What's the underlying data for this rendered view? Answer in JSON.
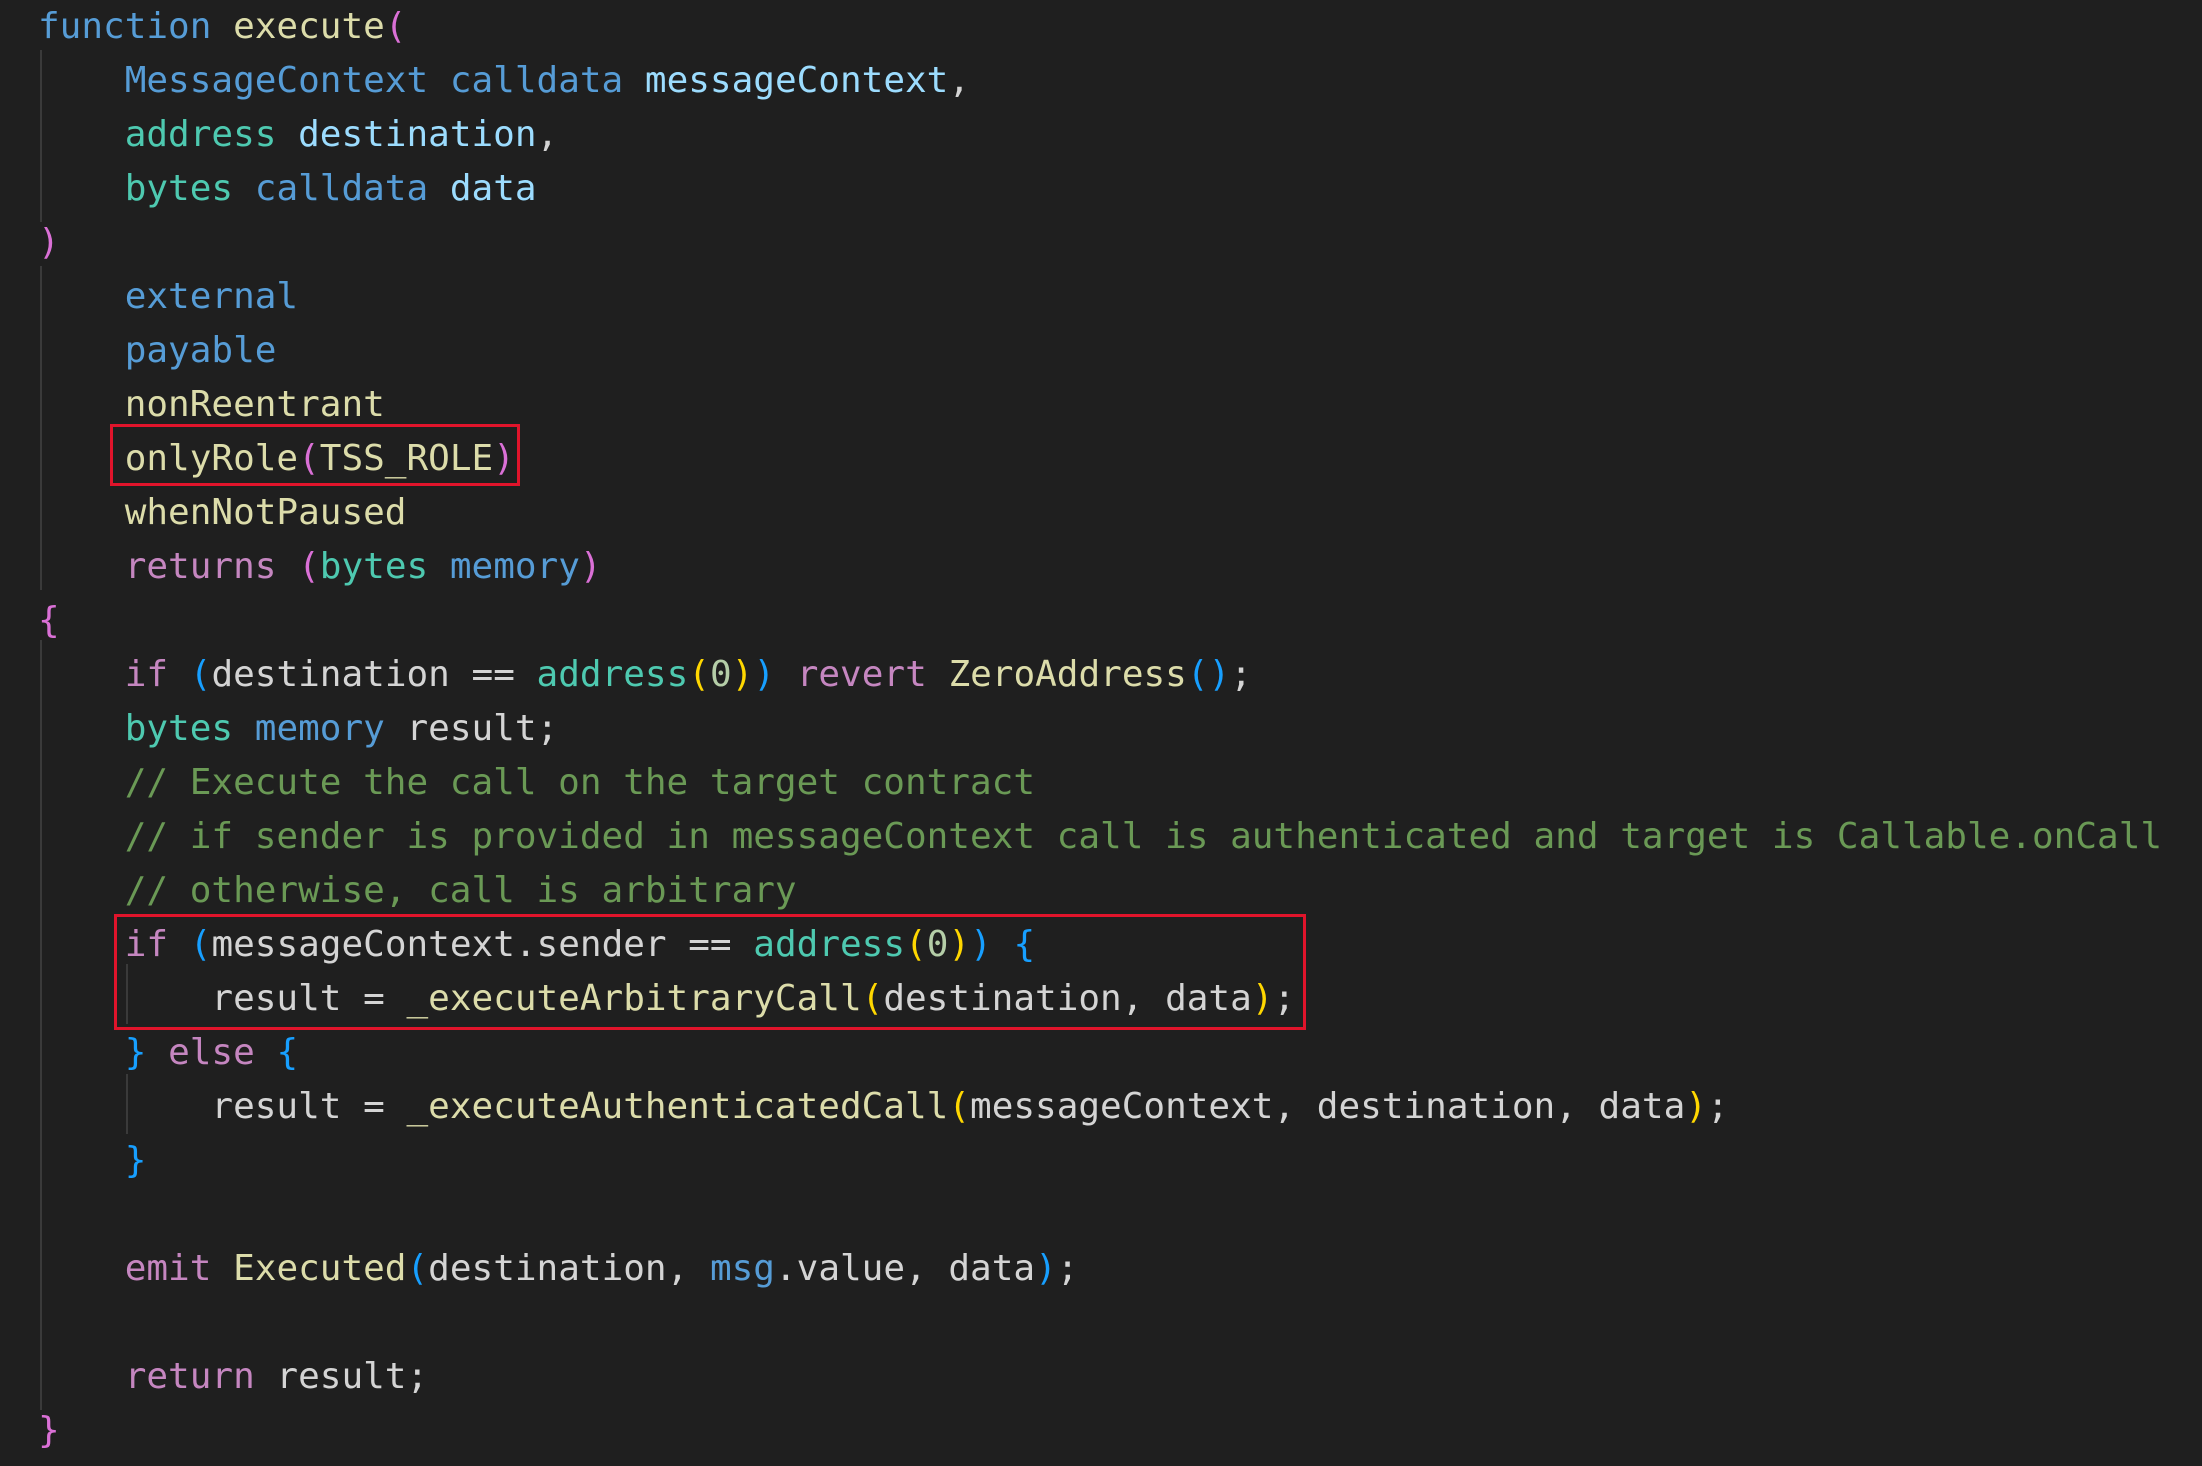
{
  "editor": {
    "highlight_color": "#e0142b",
    "lines": [
      [
        {
          "t": "function",
          "c": "kw-blue"
        },
        {
          "t": " "
        },
        {
          "t": "execute",
          "c": "fn"
        },
        {
          "t": "(",
          "c": "br-p"
        }
      ],
      [
        {
          "t": "    "
        },
        {
          "t": "MessageContext",
          "c": "kw-blue"
        },
        {
          "t": " "
        },
        {
          "t": "calldata",
          "c": "kw-blue"
        },
        {
          "t": " "
        },
        {
          "t": "messageContext",
          "c": "var"
        },
        {
          "t": ","
        }
      ],
      [
        {
          "t": "    "
        },
        {
          "t": "address",
          "c": "type"
        },
        {
          "t": " "
        },
        {
          "t": "destination",
          "c": "var"
        },
        {
          "t": ","
        }
      ],
      [
        {
          "t": "    "
        },
        {
          "t": "bytes",
          "c": "type"
        },
        {
          "t": " "
        },
        {
          "t": "calldata",
          "c": "kw-blue"
        },
        {
          "t": " "
        },
        {
          "t": "data",
          "c": "var"
        }
      ],
      [
        {
          "t": ")",
          "c": "br-p"
        }
      ],
      [
        {
          "t": "    "
        },
        {
          "t": "external",
          "c": "kw-blue"
        }
      ],
      [
        {
          "t": "    "
        },
        {
          "t": "payable",
          "c": "kw-blue"
        }
      ],
      [
        {
          "t": "    "
        },
        {
          "t": "nonReentrant",
          "c": "fn"
        }
      ],
      [
        {
          "t": "    "
        },
        {
          "t": "onlyRole",
          "c": "fn"
        },
        {
          "t": "(",
          "c": "br-p"
        },
        {
          "t": "TSS_ROLE",
          "c": "fn"
        },
        {
          "t": ")",
          "c": "br-p"
        }
      ],
      [
        {
          "t": "    "
        },
        {
          "t": "whenNotPaused",
          "c": "fn"
        }
      ],
      [
        {
          "t": "    "
        },
        {
          "t": "returns",
          "c": "kw-purple"
        },
        {
          "t": " "
        },
        {
          "t": "(",
          "c": "br-p"
        },
        {
          "t": "bytes",
          "c": "type"
        },
        {
          "t": " "
        },
        {
          "t": "memory",
          "c": "kw-blue"
        },
        {
          "t": ")",
          "c": "br-p"
        }
      ],
      [
        {
          "t": "{",
          "c": "br-p"
        }
      ],
      [
        {
          "t": "    "
        },
        {
          "t": "if",
          "c": "kw-purple"
        },
        {
          "t": " "
        },
        {
          "t": "(",
          "c": "br-b"
        },
        {
          "t": "destination == "
        },
        {
          "t": "address",
          "c": "type"
        },
        {
          "t": "(",
          "c": "br-y"
        },
        {
          "t": "0",
          "c": "num"
        },
        {
          "t": ")",
          "c": "br-y"
        },
        {
          "t": ")",
          "c": "br-b"
        },
        {
          "t": " "
        },
        {
          "t": "revert",
          "c": "kw-purple"
        },
        {
          "t": " "
        },
        {
          "t": "ZeroAddress",
          "c": "fn"
        },
        {
          "t": "()",
          "c": "br-b"
        },
        {
          "t": ";"
        }
      ],
      [
        {
          "t": "    "
        },
        {
          "t": "bytes",
          "c": "type"
        },
        {
          "t": " "
        },
        {
          "t": "memory",
          "c": "kw-blue"
        },
        {
          "t": " result;"
        }
      ],
      [
        {
          "t": "    "
        },
        {
          "t": "// Execute the call on the target contract",
          "c": "comment"
        }
      ],
      [
        {
          "t": "    "
        },
        {
          "t": "// if sender is provided in messageContext call is authenticated and target is Callable.onCall",
          "c": "comment"
        }
      ],
      [
        {
          "t": "    "
        },
        {
          "t": "// otherwise, call is arbitrary",
          "c": "comment"
        }
      ],
      [
        {
          "t": "    "
        },
        {
          "t": "if",
          "c": "kw-purple"
        },
        {
          "t": " "
        },
        {
          "t": "(",
          "c": "br-b"
        },
        {
          "t": "messageContext.sender == "
        },
        {
          "t": "address",
          "c": "type"
        },
        {
          "t": "(",
          "c": "br-y"
        },
        {
          "t": "0",
          "c": "num"
        },
        {
          "t": ")",
          "c": "br-y"
        },
        {
          "t": ")",
          "c": "br-b"
        },
        {
          "t": " "
        },
        {
          "t": "{",
          "c": "br-b"
        }
      ],
      [
        {
          "t": "        result = "
        },
        {
          "t": "_executeArbitraryCall",
          "c": "fn"
        },
        {
          "t": "(",
          "c": "br-y"
        },
        {
          "t": "destination, data"
        },
        {
          "t": ")",
          "c": "br-y"
        },
        {
          "t": ";"
        }
      ],
      [
        {
          "t": "    "
        },
        {
          "t": "}",
          "c": "br-b"
        },
        {
          "t": " "
        },
        {
          "t": "else",
          "c": "kw-purple"
        },
        {
          "t": " "
        },
        {
          "t": "{",
          "c": "br-b"
        }
      ],
      [
        {
          "t": "        result = "
        },
        {
          "t": "_executeAuthenticatedCall",
          "c": "fn"
        },
        {
          "t": "(",
          "c": "br-y"
        },
        {
          "t": "messageContext, destination, data"
        },
        {
          "t": ")",
          "c": "br-y"
        },
        {
          "t": ";"
        }
      ],
      [
        {
          "t": "    "
        },
        {
          "t": "}",
          "c": "br-b"
        }
      ],
      [
        {
          "t": ""
        }
      ],
      [
        {
          "t": "    "
        },
        {
          "t": "emit",
          "c": "kw-purple"
        },
        {
          "t": " "
        },
        {
          "t": "Executed",
          "c": "fn"
        },
        {
          "t": "(",
          "c": "br-b"
        },
        {
          "t": "destination, "
        },
        {
          "t": "msg",
          "c": "kw-blue"
        },
        {
          "t": ".value, data"
        },
        {
          "t": ")",
          "c": "br-b"
        },
        {
          "t": ";"
        }
      ],
      [
        {
          "t": ""
        }
      ],
      [
        {
          "t": "    "
        },
        {
          "t": "return",
          "c": "kw-purple"
        },
        {
          "t": " result;"
        }
      ],
      [
        {
          "t": "}",
          "c": "br-p"
        }
      ]
    ]
  }
}
